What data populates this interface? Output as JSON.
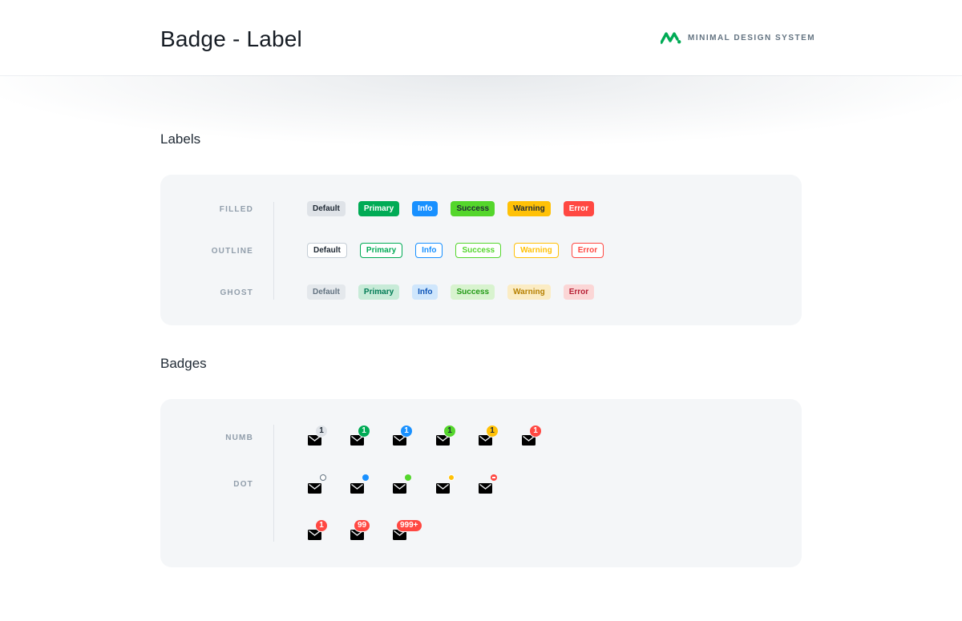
{
  "header": {
    "title": "Badge - Label",
    "brand": "MINIMAL DESIGN SYSTEM",
    "brand_color": "#00ab55"
  },
  "labels_section": {
    "title": "Labels",
    "rows": [
      {
        "name": "FILLED",
        "items": [
          "Default",
          "Primary",
          "Info",
          "Success",
          "Warning",
          "Error"
        ]
      },
      {
        "name": "OUTLINE",
        "items": [
          "Default",
          "Primary",
          "Info",
          "Success",
          "Warning",
          "Error"
        ]
      },
      {
        "name": "GHOST",
        "items": [
          "Default",
          "Primary",
          "Info",
          "Success",
          "Warning",
          "Error"
        ]
      }
    ]
  },
  "badges_section": {
    "title": "Badges",
    "numb_label": "NUMB",
    "dot_label": "DOT",
    "numb_counts": [
      "1",
      "1",
      "1",
      "1",
      "1",
      "1"
    ],
    "max_counts": [
      "1",
      "99",
      "999+"
    ],
    "icon": "mail-icon"
  },
  "colors": {
    "default": "#dfe3e8",
    "primary": "#00ab55",
    "info": "#1890ff",
    "success": "#54d62c",
    "warning": "#ffc107",
    "error": "#ff4842"
  }
}
